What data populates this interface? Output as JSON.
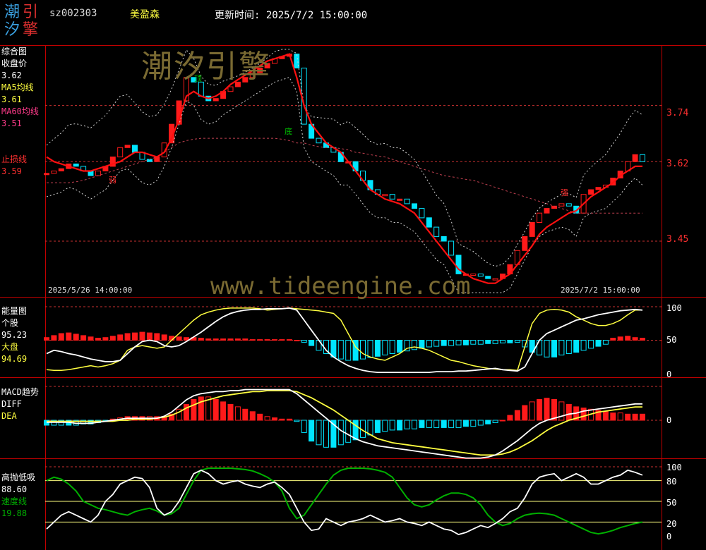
{
  "header": {
    "logo_chars": [
      "潮",
      "引",
      "汐",
      "擎"
    ],
    "stock_code": "sz002303",
    "stock_name": "美盈森",
    "update_time": "更新时间: 2025/7/2 15:00:00"
  },
  "watermarks": {
    "brand": "潮汐引擎",
    "url": "www.tideengine.com"
  },
  "colors": {
    "background": "#000000",
    "frame": "#c00000",
    "up": "#ff1a1a",
    "down": "#00e5ff",
    "white": "#ffffff",
    "yellow": "#ffff40",
    "green": "#00b000",
    "dashed": "#c83030"
  },
  "panels": {
    "main": {
      "title": "综合图",
      "close_label": "收盘价",
      "close_value": "3.62",
      "ma5_label": "MA5均线",
      "ma5_value": "3.61",
      "ma60_label": "MA60均线",
      "ma60_value": "3.51",
      "stop_label": "止损线",
      "stop_value": "3.59",
      "axis_ticks": [
        "3.74",
        "3.62",
        "3.45"
      ],
      "date_start": "2025/5/26 14:00:00",
      "date_end": "2025/7/2 15:00:00",
      "marker_top": "顶",
      "marker_bottom": "底",
      "marker_strong": "强",
      "marker_weak": "弱"
    },
    "energy": {
      "title": "能量图",
      "stock_label": "个股",
      "stock_value": "95.23",
      "market_label": "大盘",
      "market_value": "94.69",
      "axis_ticks": [
        "100",
        "50",
        "0"
      ]
    },
    "macd": {
      "title": "MACD趋势",
      "diff_label": "DIFF",
      "dea_label": "DEA",
      "axis_ticks": [
        "0"
      ]
    },
    "gpdx": {
      "title": "高抛低吸",
      "value": "88.60",
      "speed_label": "速度线",
      "speed_value": "19.88",
      "axis_ticks": [
        "100",
        "80",
        "50",
        "20",
        "0"
      ]
    }
  },
  "chart_data": [
    {
      "type": "candlestick",
      "panel": "综合图",
      "ylim": [
        3.34,
        3.86
      ],
      "y_ticks": [
        3.74,
        3.62,
        3.45
      ],
      "x_range": [
        "2025/5/26 14:00:00",
        "2025/7/2 15:00:00"
      ],
      "bars": 82,
      "close_path": [
        3.595,
        3.6,
        3.605,
        3.615,
        3.61,
        3.6,
        3.59,
        3.6,
        3.61,
        3.63,
        3.65,
        3.655,
        3.64,
        3.625,
        3.62,
        3.63,
        3.66,
        3.7,
        3.75,
        3.8,
        3.79,
        3.76,
        3.75,
        3.755,
        3.77,
        3.78,
        3.79,
        3.8,
        3.81,
        3.82,
        3.83,
        3.84,
        3.845,
        3.85,
        3.82,
        3.7,
        3.67,
        3.66,
        3.65,
        3.64,
        3.62,
        3.62,
        3.6,
        3.58,
        3.56,
        3.55,
        3.55,
        3.54,
        3.54,
        3.53,
        3.52,
        3.5,
        3.48,
        3.46,
        3.45,
        3.42,
        3.38,
        3.38,
        3.38,
        3.375,
        3.37,
        3.37,
        3.38,
        3.4,
        3.43,
        3.46,
        3.49,
        3.51,
        3.52,
        3.525,
        3.53,
        3.525,
        3.51,
        3.55,
        3.56,
        3.565,
        3.57,
        3.585,
        3.6,
        3.62,
        3.635,
        3.62
      ],
      "ma5": [
        3.63,
        3.62,
        3.615,
        3.61,
        3.605,
        3.6,
        3.6,
        3.605,
        3.61,
        3.615,
        3.62,
        3.63,
        3.64,
        3.64,
        3.635,
        3.63,
        3.64,
        3.67,
        3.71,
        3.76,
        3.77,
        3.76,
        3.755,
        3.76,
        3.77,
        3.785,
        3.795,
        3.805,
        3.815,
        3.825,
        3.835,
        3.84,
        3.845,
        3.85,
        3.8,
        3.74,
        3.7,
        3.68,
        3.66,
        3.65,
        3.64,
        3.62,
        3.6,
        3.58,
        3.56,
        3.55,
        3.54,
        3.535,
        3.53,
        3.52,
        3.51,
        3.49,
        3.47,
        3.45,
        3.43,
        3.41,
        3.39,
        3.38,
        3.37,
        3.365,
        3.36,
        3.36,
        3.37,
        3.38,
        3.4,
        3.42,
        3.44,
        3.465,
        3.48,
        3.49,
        3.5,
        3.51,
        3.515,
        3.53,
        3.545,
        3.555,
        3.565,
        3.575,
        3.59,
        3.6,
        3.61,
        3.61
      ],
      "ma60": [
        3.575,
        3.575,
        3.575,
        3.575,
        3.577,
        3.58,
        3.585,
        3.59,
        3.595,
        3.6,
        3.605,
        3.61,
        3.615,
        3.62,
        3.625,
        3.63,
        3.64,
        3.65,
        3.66,
        3.665,
        3.668,
        3.67,
        3.67,
        3.67,
        3.67,
        3.67,
        3.67,
        3.67,
        3.67,
        3.67,
        3.67,
        3.67,
        3.668,
        3.665,
        3.66,
        3.66,
        3.655,
        3.652,
        3.65,
        3.65,
        3.648,
        3.645,
        3.64,
        3.638,
        3.635,
        3.632,
        3.63,
        3.625,
        3.62,
        3.615,
        3.61,
        3.605,
        3.6,
        3.595,
        3.59,
        3.588,
        3.585,
        3.582,
        3.58,
        3.575,
        3.57,
        3.565,
        3.56,
        3.555,
        3.55,
        3.545,
        3.54,
        3.535,
        3.53,
        3.525,
        3.52,
        3.515,
        3.51,
        3.51,
        3.51,
        3.51,
        3.51,
        3.51,
        3.51,
        3.51,
        3.51,
        3.51
      ]
    },
    {
      "type": "line+bar",
      "panel": "能量图",
      "ylim": [
        0,
        100
      ],
      "y_ticks": [
        100,
        50,
        0
      ],
      "series": [
        {
          "name": "个股",
          "values": [
            30,
            35,
            33,
            30,
            28,
            25,
            22,
            20,
            18,
            18,
            20,
            30,
            40,
            48,
            50,
            48,
            42,
            40,
            42,
            48,
            55,
            62,
            70,
            78,
            85,
            90,
            93,
            95,
            96,
            96,
            97,
            97,
            97,
            98,
            95,
            80,
            65,
            50,
            35,
            25,
            18,
            12,
            8,
            5,
            3,
            2,
            2,
            2,
            2,
            2,
            2,
            2,
            2,
            3,
            3,
            3,
            4,
            4,
            5,
            6,
            7,
            8,
            6,
            5,
            4,
            10,
            30,
            50,
            60,
            65,
            70,
            75,
            80,
            82,
            85,
            88,
            90,
            92,
            94,
            95,
            96,
            95
          ]
        },
        {
          "name": "大盘",
          "values": [
            6,
            5,
            5,
            6,
            8,
            10,
            12,
            10,
            12,
            15,
            20,
            35,
            40,
            42,
            40,
            38,
            40,
            50,
            60,
            70,
            80,
            88,
            92,
            95,
            97,
            98,
            98,
            98,
            98,
            97,
            95,
            96,
            97,
            98,
            97,
            96,
            95,
            94,
            92,
            90,
            80,
            60,
            40,
            30,
            25,
            22,
            20,
            25,
            30,
            38,
            40,
            38,
            35,
            30,
            25,
            20,
            18,
            15,
            12,
            10,
            8,
            7,
            6,
            6,
            5,
            40,
            75,
            90,
            95,
            96,
            95,
            92,
            85,
            80,
            75,
            72,
            72,
            75,
            80,
            88,
            95,
            95
          ]
        }
      ],
      "bars": [
        4,
        7,
        10,
        11,
        9,
        7,
        5,
        3,
        4,
        6,
        8,
        10,
        11,
        12,
        11,
        10,
        8,
        6,
        5,
        4,
        4,
        3,
        2,
        2,
        2,
        2,
        2,
        2,
        1,
        1,
        1,
        1,
        1,
        1,
        0,
        -3,
        -8,
        -15,
        -20,
        -25,
        -28,
        -30,
        -30,
        -28,
        -26,
        -24,
        -22,
        -20,
        -18,
        -16,
        -14,
        -12,
        -10,
        -9,
        -8,
        -8,
        -7,
        -7,
        -6,
        -6,
        -5,
        -5,
        -4,
        -4,
        -3,
        -10,
        -18,
        -22,
        -25,
        -25,
        -22,
        -20,
        -18,
        -15,
        -12,
        -9,
        -6,
        3,
        5,
        6,
        4,
        3
      ]
    },
    {
      "type": "line+bar",
      "panel": "MACD趋势",
      "y_zero": 0,
      "series": [
        {
          "name": "DIFF",
          "values": [
            -2,
            -2,
            -2,
            -2,
            -3,
            -3,
            -3,
            -2,
            -1,
            0,
            1,
            2,
            2,
            2,
            2,
            2,
            4,
            8,
            14,
            20,
            24,
            26,
            27,
            28,
            28,
            29,
            29,
            30,
            30,
            30,
            30,
            30,
            30,
            30,
            26,
            20,
            14,
            8,
            2,
            -4,
            -10,
            -14,
            -18,
            -21,
            -23,
            -25,
            -26,
            -27,
            -28,
            -29,
            -30,
            -31,
            -32,
            -33,
            -34,
            -35,
            -36,
            -37,
            -37,
            -37,
            -36,
            -34,
            -30,
            -25,
            -20,
            -14,
            -8,
            -3,
            0,
            2,
            4,
            6,
            7,
            9,
            10,
            11,
            12,
            13,
            14,
            15,
            16,
            16
          ]
        },
        {
          "name": "DEA",
          "values": [
            -1,
            -1,
            -1,
            -1,
            -1,
            -1,
            -1,
            -1,
            -1,
            -1,
            0,
            0,
            1,
            1,
            1,
            2,
            3,
            5,
            8,
            12,
            15,
            18,
            20,
            22,
            24,
            25,
            26,
            27,
            28,
            28,
            29,
            29,
            29,
            29,
            28,
            25,
            22,
            18,
            14,
            10,
            5,
            0,
            -5,
            -10,
            -14,
            -18,
            -20,
            -22,
            -23,
            -24,
            -25,
            -26,
            -27,
            -28,
            -29,
            -30,
            -31,
            -32,
            -33,
            -34,
            -34,
            -34,
            -33,
            -31,
            -28,
            -24,
            -20,
            -15,
            -10,
            -6,
            -3,
            0,
            2,
            4,
            6,
            8,
            9,
            10,
            11,
            12,
            13,
            13
          ]
        }
      ],
      "bars": [
        -4,
        -4,
        -4,
        -4,
        -4,
        -3,
        -3,
        -2,
        -1,
        1,
        2,
        3,
        3,
        3,
        3,
        3,
        3,
        5,
        9,
        13,
        17,
        19,
        19,
        17,
        15,
        13,
        11,
        9,
        7,
        5,
        3,
        2,
        1,
        1,
        -1,
        -10,
        -17,
        -20,
        -22,
        -22,
        -20,
        -18,
        -16,
        -14,
        -12,
        -10,
        -9,
        -8,
        -8,
        -7,
        -7,
        -6,
        -6,
        -6,
        -6,
        -6,
        -6,
        -5,
        -5,
        -4,
        -3,
        -2,
        0,
        4,
        8,
        12,
        15,
        17,
        18,
        17,
        15,
        13,
        11,
        10,
        9,
        8,
        7,
        6,
        6,
        5,
        5,
        5
      ]
    },
    {
      "type": "line",
      "panel": "高抛低吸",
      "ylim": [
        0,
        100
      ],
      "y_ticks": [
        100,
        80,
        50,
        20,
        0
      ],
      "reference_lines": [
        80,
        50,
        20
      ],
      "series": [
        {
          "name": "高抛低吸",
          "values": [
            10,
            20,
            30,
            35,
            30,
            25,
            20,
            30,
            50,
            60,
            75,
            80,
            85,
            83,
            70,
            40,
            30,
            35,
            50,
            70,
            90,
            95,
            90,
            80,
            75,
            78,
            80,
            75,
            72,
            70,
            75,
            78,
            70,
            60,
            40,
            20,
            8,
            10,
            25,
            20,
            15,
            20,
            22,
            25,
            30,
            25,
            20,
            22,
            25,
            20,
            18,
            15,
            20,
            15,
            10,
            8,
            2,
            5,
            10,
            15,
            12,
            18,
            25,
            35,
            40,
            55,
            75,
            85,
            88,
            90,
            80,
            85,
            90,
            85,
            75,
            75,
            80,
            85,
            88,
            95,
            92,
            88
          ]
        },
        {
          "name": "速度线",
          "values": [
            80,
            85,
            82,
            75,
            65,
            50,
            45,
            40,
            38,
            35,
            32,
            30,
            35,
            38,
            40,
            36,
            30,
            32,
            40,
            60,
            80,
            95,
            98,
            98,
            98,
            98,
            97,
            96,
            94,
            90,
            85,
            78,
            65,
            40,
            25,
            30,
            45,
            60,
            75,
            88,
            95,
            98,
            98,
            98,
            97,
            95,
            92,
            85,
            70,
            55,
            45,
            42,
            45,
            52,
            58,
            62,
            62,
            60,
            55,
            45,
            30,
            20,
            15,
            18,
            25,
            30,
            32,
            33,
            32,
            30,
            25,
            20,
            15,
            10,
            5,
            3,
            5,
            8,
            12,
            15,
            18,
            20
          ]
        }
      ]
    }
  ]
}
